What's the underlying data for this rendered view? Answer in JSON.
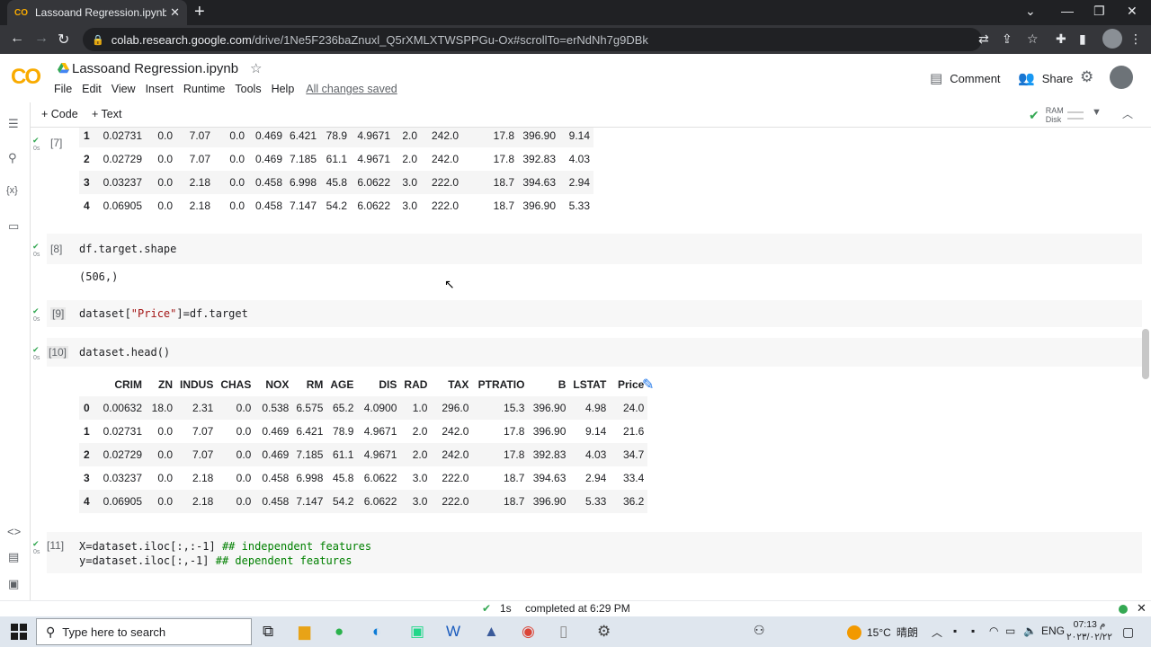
{
  "browser": {
    "tab_title": "Lassoand Regression.ipynb - Cola",
    "url_host": "colab.research.google.com",
    "url_path": "/drive/1Ne5F236baZnuxl_Q5rXMLXTWSPPGu-Ox#scrollTo=erNdNh7g9DBk"
  },
  "header": {
    "logo": "CO",
    "title": "Lassoand Regression.ipynb",
    "menus": [
      "File",
      "Edit",
      "View",
      "Insert",
      "Runtime",
      "Tools",
      "Help"
    ],
    "saved_status": "All changes saved",
    "comment_label": "Comment",
    "share_label": "Share"
  },
  "toolbar": {
    "add_code": "+ Code",
    "add_text": "+ Text",
    "ram_label": "RAM",
    "disk_label": "Disk"
  },
  "cells": {
    "c7": {
      "num": "[7]",
      "time": "0s"
    },
    "c8": {
      "num": "[8]",
      "time": "0s",
      "code": "df.target.shape",
      "output": "(506,)"
    },
    "c9": {
      "num": "[9]",
      "time": "0s",
      "code_a": "dataset[",
      "code_str": "\"Price\"",
      "code_b": "]=df.target"
    },
    "c10": {
      "num": "[10]",
      "time": "0s",
      "code": "dataset.head()"
    },
    "c11": {
      "num": "[11]",
      "time": "0s",
      "line1_code": "X=dataset.iloc[:,:-1] ",
      "line1_cmt": "## independent features",
      "line2_code": "y=dataset.iloc[:,-1] ",
      "line2_cmt": "## dependent features"
    }
  },
  "table7": {
    "rows": [
      [
        "1",
        "0.02731",
        "0.0",
        "7.07",
        "0.0",
        "0.469",
        "6.421",
        "78.9",
        "4.9671",
        "2.0",
        "242.0",
        "17.8",
        "396.90",
        "9.14"
      ],
      [
        "2",
        "0.02729",
        "0.0",
        "7.07",
        "0.0",
        "0.469",
        "7.185",
        "61.1",
        "4.9671",
        "2.0",
        "242.0",
        "17.8",
        "392.83",
        "4.03"
      ],
      [
        "3",
        "0.03237",
        "0.0",
        "2.18",
        "0.0",
        "0.458",
        "6.998",
        "45.8",
        "6.0622",
        "3.0",
        "222.0",
        "18.7",
        "394.63",
        "2.94"
      ],
      [
        "4",
        "0.06905",
        "0.0",
        "2.18",
        "0.0",
        "0.458",
        "7.147",
        "54.2",
        "6.0622",
        "3.0",
        "222.0",
        "18.7",
        "396.90",
        "5.33"
      ]
    ]
  },
  "table10": {
    "headers": [
      "",
      "CRIM",
      "ZN",
      "INDUS",
      "CHAS",
      "NOX",
      "RM",
      "AGE",
      "DIS",
      "RAD",
      "TAX",
      "PTRATIO",
      "B",
      "LSTAT",
      "Price"
    ],
    "rows": [
      [
        "0",
        "0.00632",
        "18.0",
        "2.31",
        "0.0",
        "0.538",
        "6.575",
        "65.2",
        "4.0900",
        "1.0",
        "296.0",
        "15.3",
        "396.90",
        "4.98",
        "24.0"
      ],
      [
        "1",
        "0.02731",
        "0.0",
        "7.07",
        "0.0",
        "0.469",
        "6.421",
        "78.9",
        "4.9671",
        "2.0",
        "242.0",
        "17.8",
        "396.90",
        "9.14",
        "21.6"
      ],
      [
        "2",
        "0.02729",
        "0.0",
        "7.07",
        "0.0",
        "0.469",
        "7.185",
        "61.1",
        "4.9671",
        "2.0",
        "242.0",
        "17.8",
        "392.83",
        "4.03",
        "34.7"
      ],
      [
        "3",
        "0.03237",
        "0.0",
        "2.18",
        "0.0",
        "0.458",
        "6.998",
        "45.8",
        "6.0622",
        "3.0",
        "222.0",
        "18.7",
        "394.63",
        "2.94",
        "33.4"
      ],
      [
        "4",
        "0.06905",
        "0.0",
        "2.18",
        "0.0",
        "0.458",
        "7.147",
        "54.2",
        "6.0622",
        "3.0",
        "222.0",
        "18.7",
        "396.90",
        "5.33",
        "36.2"
      ]
    ]
  },
  "status": {
    "elapsed": "1s",
    "completed": "completed at 6:29 PM"
  },
  "taskbar": {
    "search_placeholder": "Type here to search",
    "temperature": "15°C",
    "weather_text": "晴朗",
    "lang": "ENG",
    "time": "07:13 م",
    "date": "٢٠٢٣/٠٢/٢٢"
  }
}
